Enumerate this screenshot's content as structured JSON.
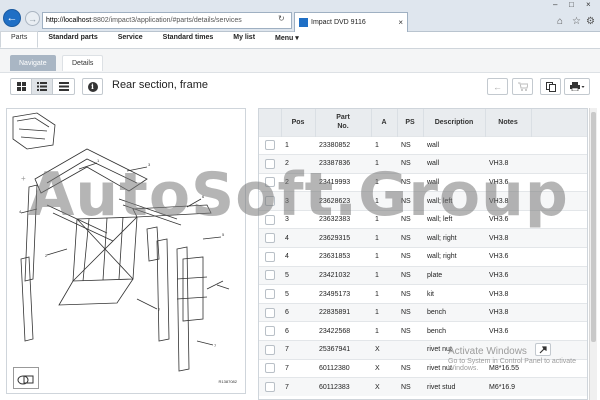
{
  "browser": {
    "address_host": "http://localhost",
    "address_rest": ":8802/impact3/application/#parts/details/services",
    "tab_title": "Impact DVD 9116"
  },
  "menu": {
    "items": [
      "Parts",
      "Standard parts",
      "Service",
      "Standard times",
      "My list",
      "Menu ▾"
    ]
  },
  "subtabs": {
    "navigate": "Navigate",
    "details": "Details"
  },
  "page": {
    "title": "Rear section, frame"
  },
  "drawing": {
    "code": "R1387082"
  },
  "table": {
    "headers": {
      "pos": "Pos",
      "part_line1": "Part",
      "part_line2": "No.",
      "a": "A",
      "ps": "PS",
      "description": "Description",
      "notes": "Notes"
    },
    "rows": [
      {
        "pos": "1",
        "part": "23380852",
        "a": "1",
        "ps": "NS",
        "desc": "wall",
        "notes": ""
      },
      {
        "pos": "2",
        "part": "23387836",
        "a": "1",
        "ps": "NS",
        "desc": "wall",
        "notes": "VH3.8"
      },
      {
        "pos": "2",
        "part": "23419993",
        "a": "1",
        "ps": "NS",
        "desc": "wall",
        "notes": "VH3.6"
      },
      {
        "pos": "3",
        "part": "23628623",
        "a": "1",
        "ps": "NS",
        "desc": "wall; left",
        "notes": "VH3.8"
      },
      {
        "pos": "3",
        "part": "23632383",
        "a": "1",
        "ps": "NS",
        "desc": "wall; left",
        "notes": "VH3.6"
      },
      {
        "pos": "4",
        "part": "23629315",
        "a": "1",
        "ps": "NS",
        "desc": "wall; right",
        "notes": "VH3.8"
      },
      {
        "pos": "4",
        "part": "23631853",
        "a": "1",
        "ps": "NS",
        "desc": "wall; right",
        "notes": "VH3.6"
      },
      {
        "pos": "5",
        "part": "23421032",
        "a": "1",
        "ps": "NS",
        "desc": "plate",
        "notes": "VH3.6"
      },
      {
        "pos": "5",
        "part": "23495173",
        "a": "1",
        "ps": "NS",
        "desc": "kit",
        "notes": "VH3.8"
      },
      {
        "pos": "6",
        "part": "22835891",
        "a": "1",
        "ps": "NS",
        "desc": "bench",
        "notes": "VH3.8"
      },
      {
        "pos": "6",
        "part": "23422568",
        "a": "1",
        "ps": "NS",
        "desc": "bench",
        "notes": "VH3.6"
      },
      {
        "pos": "7",
        "part": "25367941",
        "a": "X",
        "ps": "",
        "desc": "rivet nut",
        "notes": ""
      },
      {
        "pos": "7",
        "part": "60112380",
        "a": "X",
        "ps": "NS",
        "desc": "rivet nut",
        "notes": "M8*16.55"
      },
      {
        "pos": "7",
        "part": "60112383",
        "a": "X",
        "ps": "NS",
        "desc": "rivet stud",
        "notes": "M6*16.9"
      }
    ]
  },
  "watermark": {
    "text": "AutoSoft.Group"
  },
  "activation": {
    "line1": "Activate Windows",
    "line2": "Go to System in Control Panel to activate Windows."
  },
  "colors": {
    "accent": "#1f6fc5",
    "navigate_tab": "#a9b6c4",
    "header_bg": "#e9ecef"
  },
  "icons": [
    "back-arrow-icon",
    "forward-arrow-icon",
    "refresh-icon",
    "home-icon",
    "star-icon",
    "gear-icon",
    "thumbnail-grid-icon",
    "list-icon",
    "table-icon",
    "info-icon",
    "arrow-left-icon",
    "cart-icon",
    "copy-icon",
    "print-icon",
    "tool-icon"
  ]
}
